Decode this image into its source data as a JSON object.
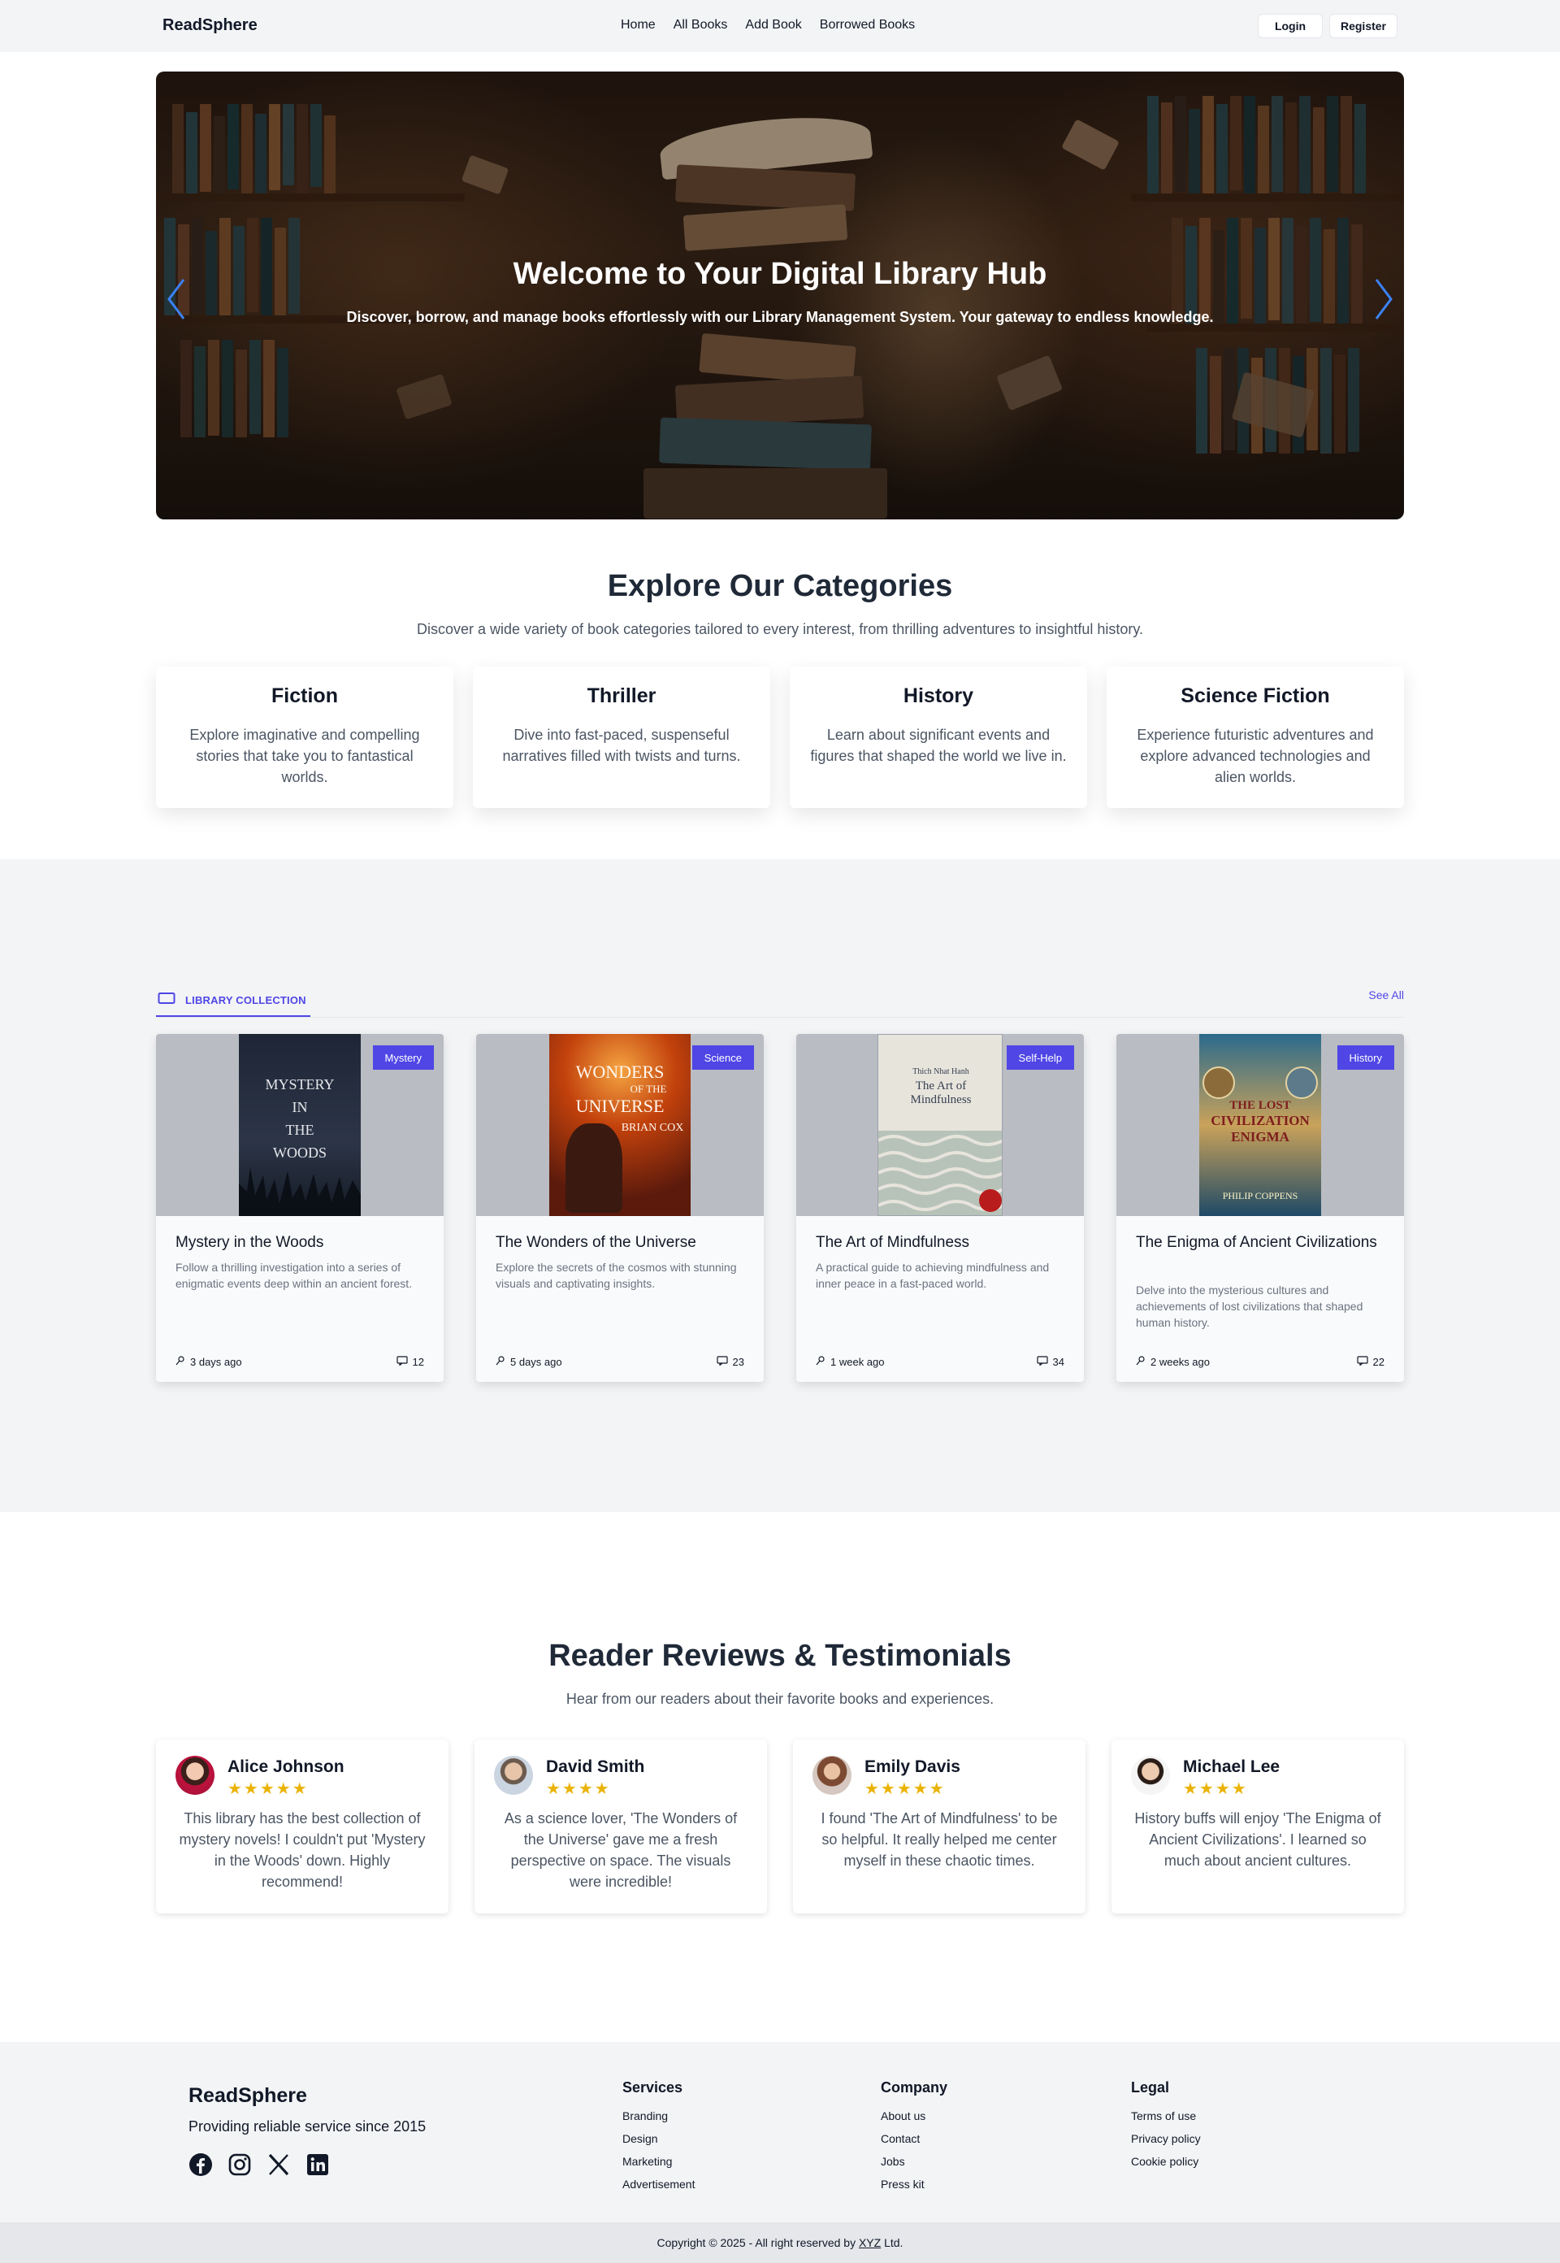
{
  "navbar": {
    "brand": "ReadSphere",
    "links": [
      "Home",
      "All Books",
      "Add Book",
      "Borrowed Books"
    ],
    "login": "Login",
    "register": "Register"
  },
  "hero": {
    "title": "Welcome to Your Digital Library Hub",
    "subtitle": "Discover, borrow, and manage books effortlessly with our Library Management System. Your gateway to endless knowledge.",
    "prev_icon": "chevron-left-icon",
    "next_icon": "chevron-right-icon"
  },
  "categories": {
    "title": "Explore Our Categories",
    "subtitle": "Discover a wide variety of book categories tailored to every interest, from thrilling adventures to insightful history.",
    "items": [
      {
        "name": "Fiction",
        "description": "Explore imaginative and compelling stories that take you to fantastical worlds."
      },
      {
        "name": "Thriller",
        "description": "Dive into fast-paced, suspenseful narratives filled with twists and turns."
      },
      {
        "name": "History",
        "description": "Learn about significant events and figures that shaped the world we live in."
      },
      {
        "name": "Science Fiction",
        "description": "Experience futuristic adventures and explore advanced technologies and alien worlds."
      }
    ]
  },
  "library": {
    "tab_label": "LIBRARY COLLECTION",
    "tab_icon": "book-icon",
    "see_all": "See All",
    "books": [
      {
        "badge": "Mystery",
        "title": "Mystery in the Woods",
        "description": "Follow a thrilling investigation into a series of enigmatic events deep within an ancient forest.",
        "time": "3 days ago",
        "comments": "12",
        "cover": {
          "lines": [
            "MYSTERY",
            "IN",
            "THE",
            "WOODS"
          ]
        }
      },
      {
        "badge": "Science",
        "title": "The Wonders of the Universe",
        "description": "Explore the secrets of the cosmos with stunning visuals and captivating insights.",
        "time": "5 days ago",
        "comments": "23",
        "cover": {
          "title1": "WONDERS",
          "title2": "OF THE",
          "title3": "UNIVERSE",
          "author": "BRIAN COX"
        }
      },
      {
        "badge": "Self-Help",
        "title": "The Art of Mindfulness",
        "description": "A practical guide to achieving mindfulness and inner peace in a fast-paced world.",
        "time": "1 week ago",
        "comments": "34",
        "cover": {
          "author": "Thich Nhat Hanh",
          "title1": "The Art of",
          "title2": "Mindfulness"
        }
      },
      {
        "badge": "History",
        "title": "The Enigma of Ancient Civilizations",
        "description": "Delve into the mysterious cultures and achievements of lost civilizations that shaped human history.",
        "time": "2 weeks ago",
        "comments": "22",
        "cover": {
          "title1": "THE LOST",
          "title2": "CIVILIZATION",
          "title3": "ENIGMA",
          "author": "PHILIP COPPENS"
        }
      }
    ]
  },
  "reviews": {
    "title": "Reader Reviews & Testimonials",
    "subtitle": "Hear from our readers about their favorite books and experiences.",
    "items": [
      {
        "name": "Alice Johnson",
        "stars": "★★★★★",
        "rating": 5,
        "text": "This library has the best collection of mystery novels! I couldn't put 'Mystery in the Woods' down. Highly recommend!"
      },
      {
        "name": "David Smith",
        "stars": "★★★★",
        "rating": 4,
        "text": "As a science lover, 'The Wonders of the Universe' gave me a fresh perspective on space. The visuals were incredible!"
      },
      {
        "name": "Emily Davis",
        "stars": "★★★★★",
        "rating": 5,
        "text": "I found 'The Art of Mindfulness' to be so helpful. It really helped me center myself in these chaotic times."
      },
      {
        "name": "Michael Lee",
        "stars": "★★★★",
        "rating": 4,
        "text": "History buffs will enjoy 'The Enigma of Ancient Civilizations'. I learned so much about ancient cultures."
      }
    ]
  },
  "footer": {
    "brand": "ReadSphere",
    "tagline": "Providing reliable service since 2015",
    "socials": [
      "facebook-icon",
      "instagram-icon",
      "x-icon",
      "linkedin-icon"
    ],
    "columns": [
      {
        "title": "Services",
        "links": [
          "Branding",
          "Design",
          "Marketing",
          "Advertisement"
        ]
      },
      {
        "title": "Company",
        "links": [
          "About us",
          "Contact",
          "Jobs",
          "Press kit"
        ]
      },
      {
        "title": "Legal",
        "links": [
          "Terms of use",
          "Privacy policy",
          "Cookie policy"
        ]
      }
    ],
    "copyright_prefix": "Copyright © 2025 - All right reserved by ",
    "copyright_company": "XYZ",
    "copyright_suffix": " Ltd."
  },
  "colors": {
    "accent": "#4f46e5",
    "star": "#eab308",
    "hero_arrow": "#3b82f6",
    "section_gray": "#f3f4f6"
  }
}
